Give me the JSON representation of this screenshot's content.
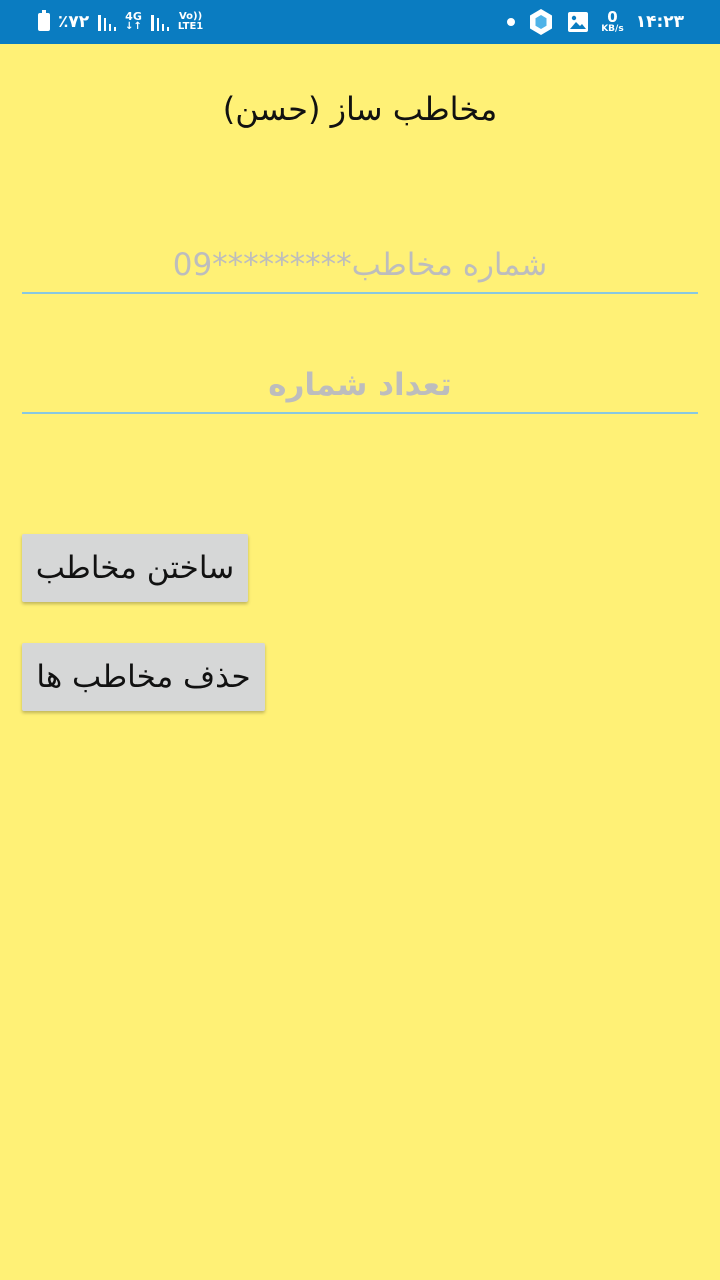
{
  "status_bar": {
    "battery_text": "٪۷۲",
    "network_4g": "4G",
    "volte": "Vo))",
    "lte": "LTE1",
    "data_speed": "0",
    "data_unit": "KB/s",
    "time": "۱۴:۲۳",
    "color": "#0A7CC1"
  },
  "app": {
    "title": "مخاطب ساز (حسن)",
    "background": "#FFF176"
  },
  "form": {
    "phone_placeholder": "شماره مخاطب*********09",
    "phone_value": "",
    "count_placeholder": "تعداد شماره",
    "count_value": ""
  },
  "buttons": {
    "create_label": "ساختن مخاطب",
    "delete_label": "حذف مخاطب ها"
  }
}
